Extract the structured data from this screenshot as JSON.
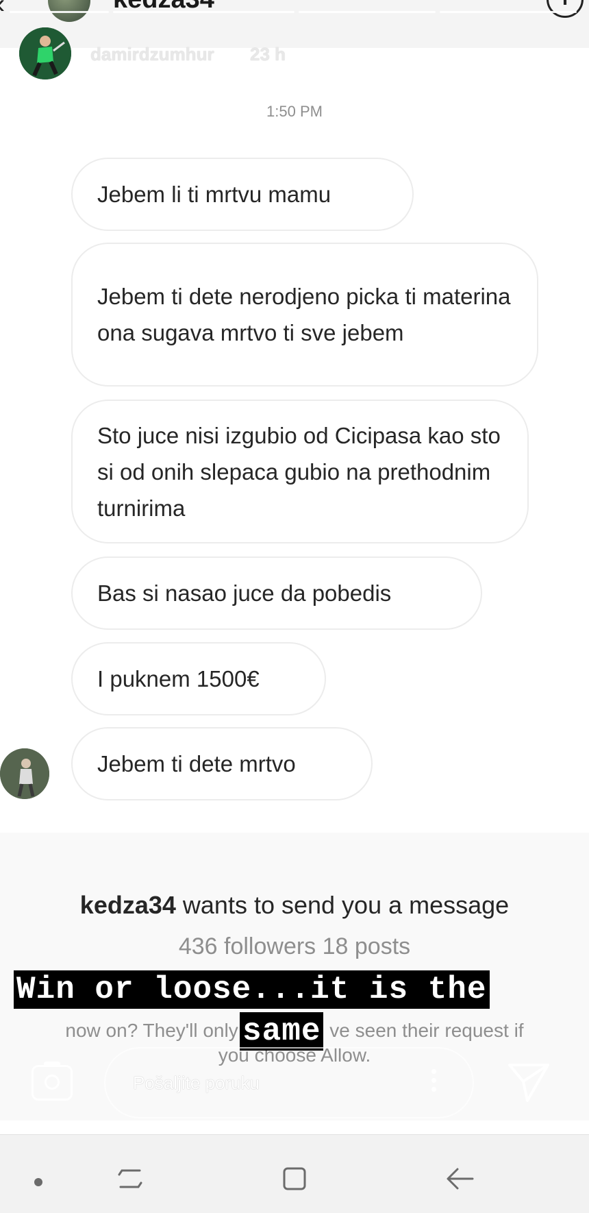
{
  "dm_header": {
    "title": "kedza34",
    "info_icon": "info-icon"
  },
  "story": {
    "username": "damirdzumhur",
    "time_ago": "23 h"
  },
  "conversation": {
    "timestamp": "1:50 PM",
    "messages": [
      "Jebem li ti mrtvu mamu",
      "Jebem ti dete nerodjeno picka ti materina ona sugava mrtvo ti sve jebem",
      "Sto juce nisi izgubio od Cicipasa kao sto si od onih slepaca gubio na prethodnim turnirima",
      "Bas si nasao juce da pobedis",
      "I puknem 1500€",
      "Jebem ti dete mrtvo"
    ]
  },
  "request": {
    "username": "kedza34",
    "title_suffix": " wants to send you a message",
    "stats": "436 followers 18 posts",
    "description_left": "now on? They'll only",
    "description_right": "ve seen their request if",
    "description_line2": "you choose Allow."
  },
  "captions": {
    "line1": "Win or loose...it is the",
    "line2": "same"
  },
  "reply": {
    "placeholder": "Pošaljite poruku"
  },
  "colors": {
    "bubble_border": "#ececec",
    "muted_text": "#8e8e8e",
    "caption_bg": "#000000"
  }
}
